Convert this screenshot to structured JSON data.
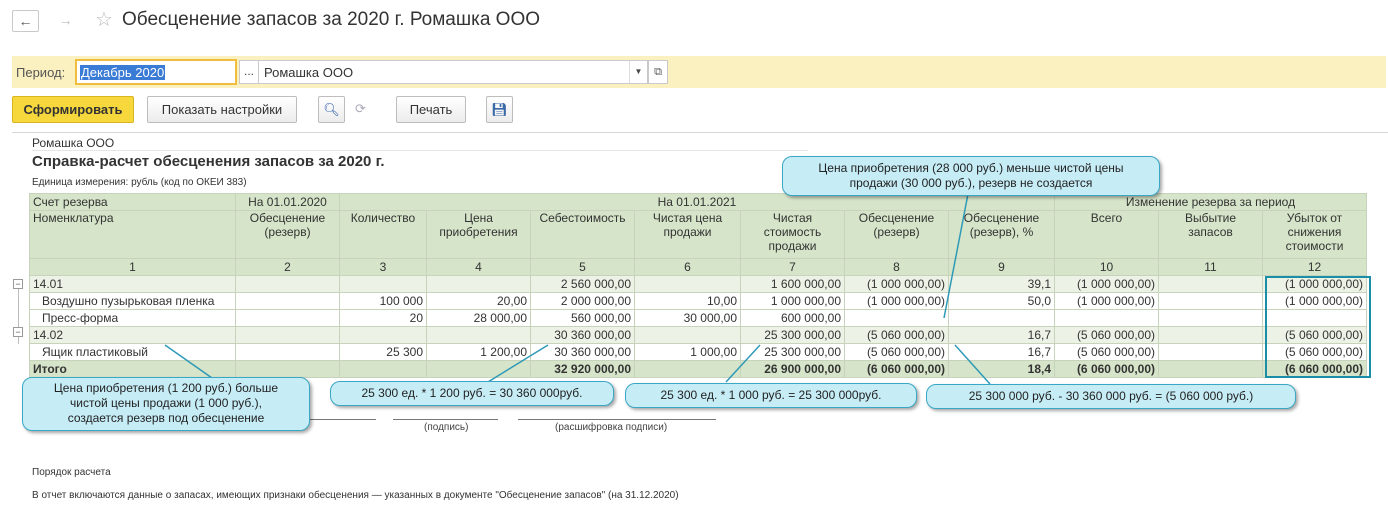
{
  "window": {
    "title": "Обесценение запасов за 2020 г. Ромашка ООО",
    "back_icon": "←",
    "forward_icon": "→",
    "star_icon": "☆"
  },
  "filters": {
    "period_label": "Период:",
    "period_value": "Декабрь 2020",
    "period_button": "...",
    "org_value": "Ромашка ООО"
  },
  "toolbar": {
    "generate_label": "Сформировать",
    "settings_label": "Показать настройки",
    "print_label": "Печать"
  },
  "report": {
    "organization": "Ромашка ООО",
    "title": "Справка-расчет обесценения запасов за 2020 г.",
    "unit": "Единица измерения:  рубль (код по ОКЕИ 383)",
    "header_top": {
      "account": "Счет резерва",
      "date1": "На 01.01.2020",
      "date2": "На 01.01.2021",
      "change": "Изменение резерва за период"
    },
    "columns": [
      "Номенклатура",
      "Обесценение (резерв)",
      "Количество",
      "Цена приобретения",
      "Себестоимость",
      "Чистая цена продажи",
      "Чистая стоимость продажи",
      "Обесценение (резерв)",
      "Обесценение (резерв), %",
      "Всего",
      "Выбытие запасов",
      "Убыток от снижения стоимости"
    ],
    "column_numbers": [
      "1",
      "2",
      "3",
      "4",
      "5",
      "6",
      "7",
      "8",
      "9",
      "10",
      "11",
      "12"
    ],
    "rows": [
      {
        "type": "group",
        "cells": [
          "14.01",
          "",
          "",
          "",
          "2 560 000,00",
          "",
          "1 600 000,00",
          "(1 000 000,00)",
          "39,1",
          "(1 000 000,00)",
          "",
          "(1 000 000,00)"
        ]
      },
      {
        "type": "item",
        "cells": [
          "Воздушно пузырьковая пленка",
          "",
          "100 000",
          "20,00",
          "2 000 000,00",
          "10,00",
          "1 000 000,00",
          "(1 000 000,00)",
          "50,0",
          "(1 000 000,00)",
          "",
          "(1 000 000,00)"
        ]
      },
      {
        "type": "item",
        "cells": [
          "Пресс-форма",
          "",
          "20",
          "28 000,00",
          "560 000,00",
          "30 000,00",
          "600 000,00",
          "",
          "",
          "",
          "",
          ""
        ]
      },
      {
        "type": "group",
        "cells": [
          "14.02",
          "",
          "",
          "",
          "30 360 000,00",
          "",
          "25 300 000,00",
          "(5 060 000,00)",
          "16,7",
          "(5 060 000,00)",
          "",
          "(5 060 000,00)"
        ]
      },
      {
        "type": "item",
        "cells": [
          "Ящик пластиковый",
          "",
          "25 300",
          "1 200,00",
          "30 360 000,00",
          "1 000,00",
          "25 300 000,00",
          "(5 060 000,00)",
          "16,7",
          "(5 060 000,00)",
          "",
          "(5 060 000,00)"
        ]
      },
      {
        "type": "total",
        "cells": [
          "Итого",
          "",
          "",
          "",
          "32 920 000,00",
          "",
          "26 900 000,00",
          "(6 060 000,00)",
          "18,4",
          "(6 060 000,00)",
          "",
          "(6 060 000,00)"
        ]
      }
    ],
    "signature_label": "(подпись)",
    "decoding_label": "(расшифровка подписи)",
    "order_title": "Порядок расчета",
    "order_text": "В отчет включаются данные о запасах, имеющих признаки обесценения — указанных в документе \"Обесценение запасов\" (на 31.12.2020)"
  },
  "callouts": {
    "top": "Цена приобретения (28 000 руб.) меньше чистой цены продажи (30 000 руб.), резерв не создается",
    "left": "Цена приобретения (1 200 руб.) больше чистой цены продажи (1 000 руб.), создается резерв под обесценение",
    "cost": "25 300 ед. * 1 200 руб. = 30 360 000руб.",
    "net": "25 300 ед. * 1 000 руб. = 25 300 000руб.",
    "diff": "25 300 000 руб. - 30 360 000 руб. = (5 060 000 руб.)"
  },
  "colors": {
    "accent_yellow": "#f6d83c",
    "filter_bg": "#fbf0bf",
    "header_green": "#d6e4c9",
    "callout_bg": "#c6ecf6",
    "callout_border": "#3aa7c4",
    "highlight": "#1a8ea6"
  }
}
